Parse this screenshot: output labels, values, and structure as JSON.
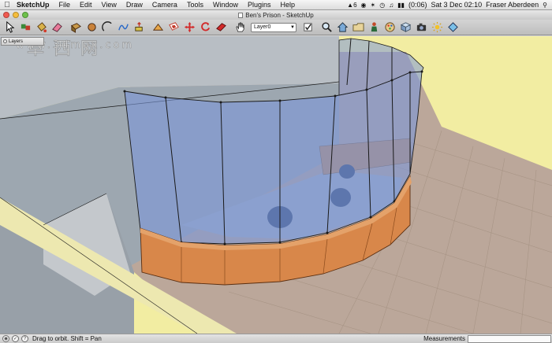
{
  "menubar": {
    "app_menu": "SketchUp",
    "menus": [
      "File",
      "Edit",
      "View",
      "Draw",
      "Camera",
      "Tools",
      "Window",
      "Plugins",
      "Help"
    ],
    "status": {
      "battery": "(0:06)",
      "datetime": "Sat 3 Dec  02:10",
      "user": "Fraser Aberdeen",
      "adobe_badge": "6"
    }
  },
  "window": {
    "title": "Ben's Prison - SketchUp"
  },
  "toolbar": {
    "layer_value": "Layer0",
    "tools": [
      "select-tool",
      "paint-tool",
      "eraser-tool",
      "line-tool",
      "rectangle-tool",
      "circle-tool",
      "arc-tool",
      "freehand-tool",
      "push-pull-tool",
      "offset-tool",
      "move-tool",
      "rotate-tool",
      "scale-tool",
      "follow-me-tool",
      "tape-measure-tool",
      "orbit-tool",
      "pan-tool",
      "zoom-tool"
    ]
  },
  "layers_panel": {
    "title": "Layers"
  },
  "watermark": {
    "chinese": "草西网",
    "url": "www.3dmox.com"
  },
  "statusbar": {
    "hint": "Drag to orbit.  Shift = Pan",
    "measurements_label": "Measurements",
    "measurements_value": ""
  },
  "colors": {
    "wall": "#9da7b0",
    "floor": "#bba79a",
    "ground": "#f2eda2",
    "glass": "#7d98d8",
    "wood": "#d8874a",
    "edge": "#1a1a1a"
  }
}
